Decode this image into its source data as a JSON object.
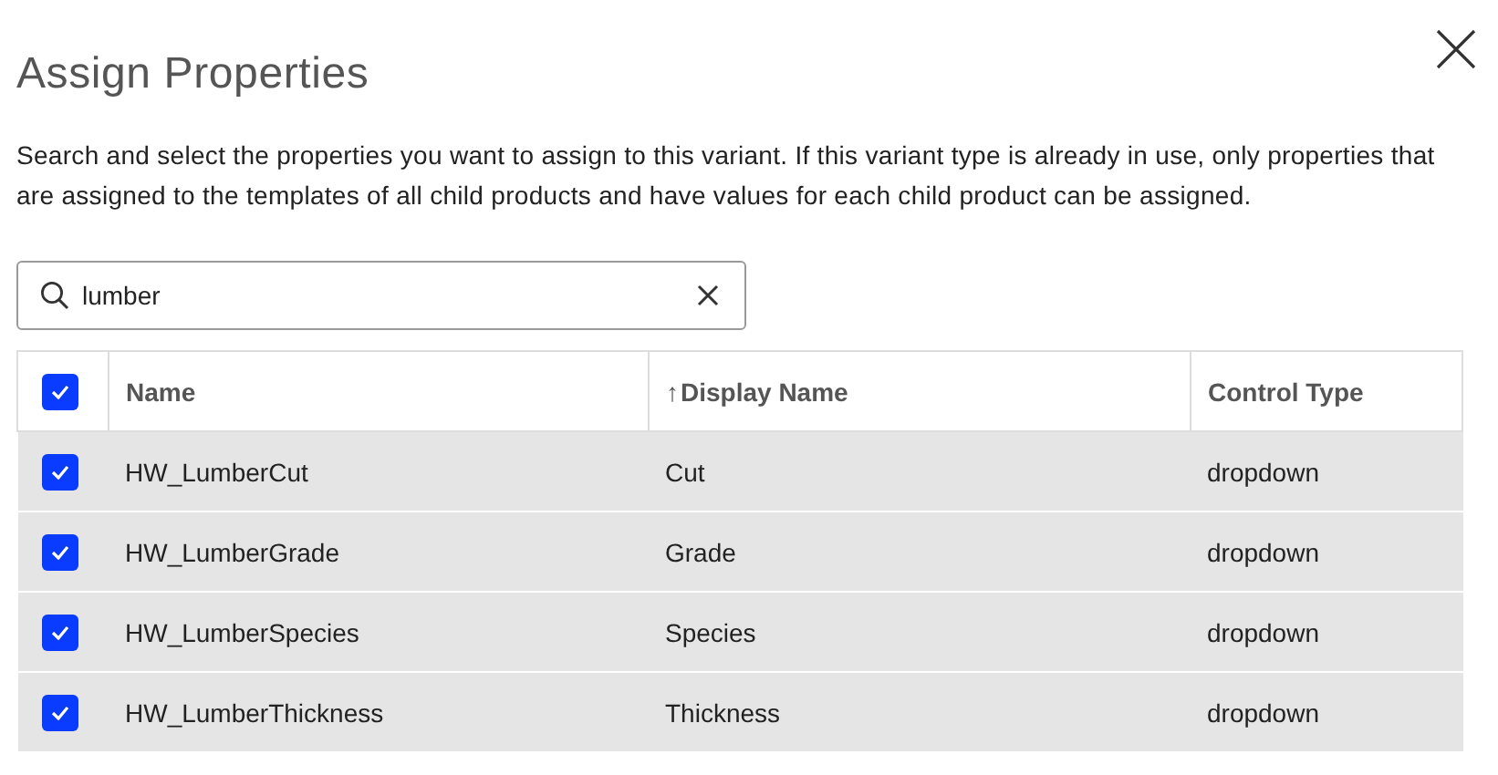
{
  "dialog": {
    "title": "Assign Properties",
    "description": "Search and select the properties you want to assign to this variant. If this variant type is already in use, only properties that are assigned to the templates of all child products and have values for each child product can be assigned."
  },
  "search": {
    "value": "lumber"
  },
  "table": {
    "all_checked": true,
    "columns": [
      {
        "label": "Name"
      },
      {
        "label": "Display Name",
        "sort_glyph": "↑"
      },
      {
        "label": "Control Type"
      }
    ],
    "rows": [
      {
        "checked": true,
        "selected": true,
        "cells": [
          "HW_LumberCut",
          "Cut",
          "dropdown"
        ]
      },
      {
        "checked": true,
        "selected": true,
        "cells": [
          "HW_LumberGrade",
          "Grade",
          "dropdown"
        ]
      },
      {
        "checked": true,
        "selected": true,
        "cells": [
          "HW_LumberSpecies",
          "Species",
          "dropdown"
        ]
      },
      {
        "checked": true,
        "selected": true,
        "cells": [
          "HW_LumberThickness",
          "Thickness",
          "dropdown"
        ]
      }
    ]
  }
}
